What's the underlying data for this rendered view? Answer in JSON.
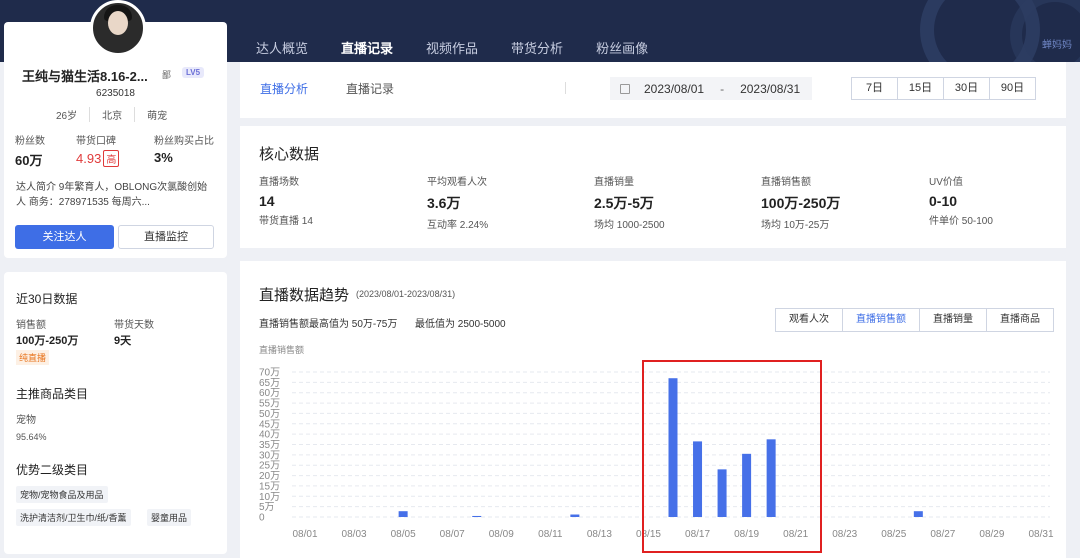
{
  "nav": {
    "tabs": [
      "达人概览",
      "直播记录",
      "视频作品",
      "带货分析",
      "粉丝画像"
    ],
    "active": 1
  },
  "brand": "蝉妈妈",
  "profile": {
    "name": "王纯与猫生活8.16-2...",
    "tag": "鄙",
    "level": "LV5",
    "id": "6235018",
    "age": "26岁",
    "city": "北京",
    "category": "萌宠",
    "stats": [
      {
        "label": "粉丝数",
        "value": "60万"
      },
      {
        "label": "带货口碑",
        "value": "4.93",
        "badge": "高"
      },
      {
        "label": "粉丝购买占比",
        "value": "3%"
      }
    ],
    "intro": "达人简介 9年繁育人，OBLONG次氯酸创始人 商务：278971535 每周六...",
    "follow_btn": "关注达人",
    "monitor_btn": "直播监控"
  },
  "recent": {
    "title": "近30日数据",
    "sales_label": "销售额",
    "sales_value": "100万-250万",
    "days_label": "带货天数",
    "days_value": "9天",
    "pure": "纯直播",
    "main_cat_title": "主推商品类目",
    "main_cat": "宠物",
    "main_cat_pct": "95.64%",
    "sub_cat_title": "优势二级类目",
    "chips": [
      "宠物/宠物食品及用品",
      "洗护清洁剂/卫生巾/纸/香薰",
      "婴童用品"
    ]
  },
  "subtabs": [
    "直播分析",
    "直播记录"
  ],
  "date": {
    "start": "2023/08/01",
    "sep": "-",
    "end": "2023/08/31"
  },
  "days": [
    "7日",
    "15日",
    "30日",
    "90日"
  ],
  "core": {
    "title": "核心数据",
    "items": [
      {
        "label": "直播场数",
        "value": "14",
        "sub": "带货直播 14"
      },
      {
        "label": "平均观看人次",
        "value": "3.6万",
        "sub": "互动率 2.24%"
      },
      {
        "label": "直播销量",
        "value": "2.5万-5万",
        "sub": "场均 1000-2500"
      },
      {
        "label": "直播销售额",
        "value": "100万-250万",
        "sub": "场均 10万-25万"
      },
      {
        "label": "UV价值",
        "value": "0-10",
        "sub": "件单价 50-100"
      }
    ]
  },
  "trend": {
    "title": "直播数据趋势",
    "range": "(2023/08/01-2023/08/31)",
    "note_max": "直播销售额最高值为 50万-75万",
    "note_min": "最低值为 2500-5000",
    "metric_tabs": [
      "观看人次",
      "直播销售额",
      "直播销量",
      "直播商品"
    ],
    "active_metric": 1,
    "ylabel": "直播销售额"
  },
  "chart_data": {
    "type": "bar",
    "ylabel": "直播销售额",
    "y_ticks": [
      "0",
      "5万",
      "10万",
      "15万",
      "20万",
      "25万",
      "30万",
      "35万",
      "40万",
      "45万",
      "50万",
      "55万",
      "60万",
      "65万",
      "70万"
    ],
    "ylim": [
      0,
      70
    ],
    "x_ticks": [
      "08/01",
      "08/03",
      "08/05",
      "08/07",
      "08/09",
      "08/11",
      "08/13",
      "08/15",
      "08/17",
      "08/19",
      "08/21",
      "08/23",
      "08/25",
      "08/27",
      "08/29",
      "08/31"
    ],
    "categories": [
      "08/01",
      "08/02",
      "08/03",
      "08/04",
      "08/05",
      "08/06",
      "08/07",
      "08/08",
      "08/09",
      "08/10",
      "08/11",
      "08/12",
      "08/13",
      "08/14",
      "08/15",
      "08/16",
      "08/17",
      "08/18",
      "08/19",
      "08/20",
      "08/21",
      "08/22",
      "08/23",
      "08/24",
      "08/25",
      "08/26",
      "08/27",
      "08/28",
      "08/29",
      "08/30",
      "08/31"
    ],
    "values": [
      0,
      0,
      0,
      0,
      2.8,
      0,
      0,
      0.5,
      0,
      0,
      0,
      1.2,
      0,
      0,
      0,
      67,
      36.5,
      23,
      30.5,
      37.5,
      0,
      0,
      0,
      0,
      0,
      2.8,
      0,
      0,
      0,
      0,
      0
    ],
    "color": "#4670e8",
    "grid": true
  }
}
